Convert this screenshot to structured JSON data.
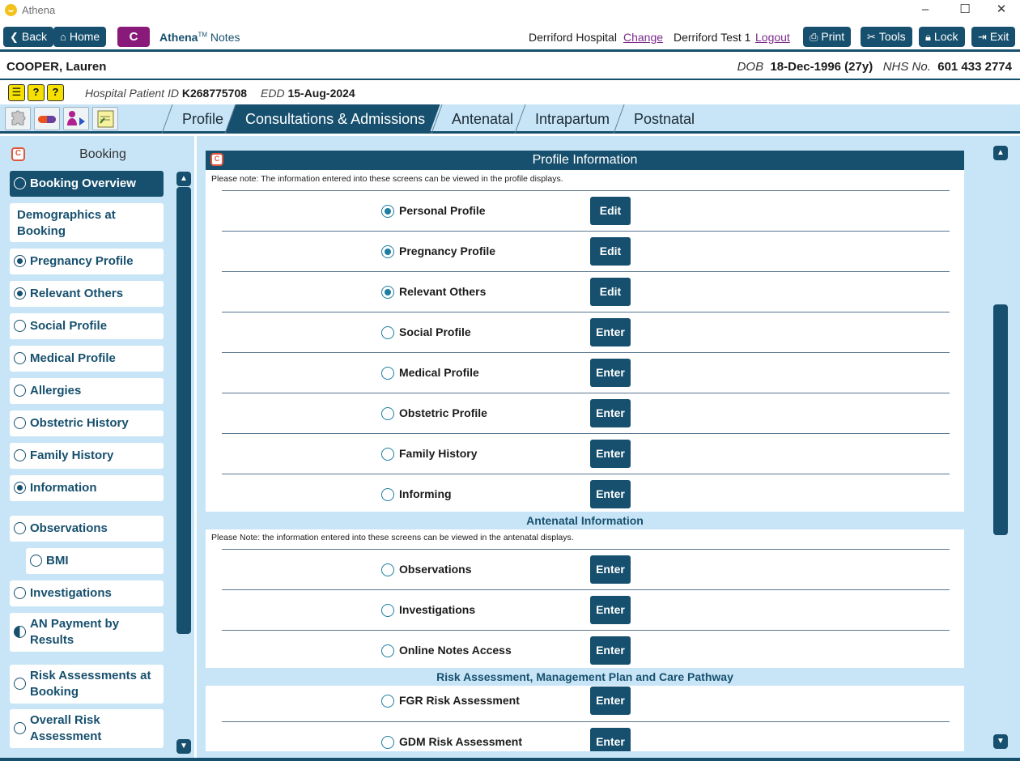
{
  "window": {
    "title": "Athena",
    "minimize": "–",
    "maximize": "☐",
    "close": "✕"
  },
  "toolbar": {
    "back": "Back",
    "home": "Home",
    "c_label": "C",
    "brand": "Athena",
    "brand_tm": "TM",
    "brand_suffix": "Notes",
    "hospital": "Derriford Hospital",
    "change": "Change",
    "user": "Derriford Test 1",
    "logout": "Logout",
    "print": "Print",
    "tools": "Tools",
    "lock": "Lock",
    "exit": "Exit"
  },
  "patient": {
    "name": "COOPER, Lauren",
    "dob_label": "DOB",
    "dob": "18-Dec-1996 (27y)",
    "nhs_label": "NHS No.",
    "nhs": "601 433 2774",
    "hospital_id_label": "Hospital Patient ID",
    "hospital_id": "K268775708",
    "edd_label": "EDD",
    "edd": "15-Aug-2024"
  },
  "tabs": [
    "Profile",
    "Consultations & Admissions",
    "Antenatal",
    "Intrapartum",
    "Postnatal"
  ],
  "sidebar": {
    "title": "Booking",
    "items": [
      {
        "label": "Booking Overview",
        "state": "empty"
      },
      {
        "label": "Demographics at Booking",
        "state": "none"
      },
      {
        "label": "Pregnancy Profile",
        "state": "filled"
      },
      {
        "label": "Relevant Others",
        "state": "filled"
      },
      {
        "label": "Social Profile",
        "state": "empty"
      },
      {
        "label": "Medical Profile",
        "state": "empty"
      },
      {
        "label": "Allergies",
        "state": "empty"
      },
      {
        "label": "Obstetric History",
        "state": "empty"
      },
      {
        "label": "Family History",
        "state": "empty"
      },
      {
        "label": "Information",
        "state": "filled"
      },
      {
        "label": "Observations",
        "state": "empty"
      },
      {
        "label": "BMI",
        "state": "empty"
      },
      {
        "label": "Investigations",
        "state": "empty"
      },
      {
        "label": "AN Payment by Results",
        "state": "half"
      },
      {
        "label": "Risk Assessments at Booking",
        "state": "empty"
      },
      {
        "label": "Overall Risk Assessment",
        "state": "empty"
      }
    ]
  },
  "main": {
    "profile_header": "Profile Information",
    "profile_note": "Please note: The information entered into these screens can be viewed in the profile displays.",
    "profile_rows": [
      {
        "label": "Personal Profile",
        "button": "Edit",
        "filled": true
      },
      {
        "label": "Pregnancy Profile",
        "button": "Edit",
        "filled": true
      },
      {
        "label": "Relevant Others",
        "button": "Edit",
        "filled": true
      },
      {
        "label": "Social Profile",
        "button": "Enter",
        "filled": false
      },
      {
        "label": "Medical Profile",
        "button": "Enter",
        "filled": false
      },
      {
        "label": "Obstetric Profile",
        "button": "Enter",
        "filled": false
      },
      {
        "label": "Family History",
        "button": "Enter",
        "filled": false
      },
      {
        "label": "Informing",
        "button": "Enter",
        "filled": false
      }
    ],
    "antenatal_header": "Antenatal Information",
    "antenatal_note": "Please Note: the information entered into these screens can be viewed in the antenatal displays.",
    "antenatal_rows": [
      {
        "label": "Observations",
        "button": "Enter",
        "filled": false
      },
      {
        "label": "Investigations",
        "button": "Enter",
        "filled": false
      },
      {
        "label": "Online Notes Access",
        "button": "Enter",
        "filled": false
      }
    ],
    "risk_header": "Risk Assessment, Management Plan and Care Pathway",
    "risk_rows": [
      {
        "label": "FGR Risk Assessment",
        "button": "Enter",
        "filled": false
      },
      {
        "label": "GDM Risk Assessment",
        "button": "Enter",
        "filled": false
      }
    ]
  },
  "colors": {
    "primary": "#17506e",
    "light": "#c8e5f7",
    "c_purple": "#8a1a7a",
    "link": "#7a2a8a"
  }
}
